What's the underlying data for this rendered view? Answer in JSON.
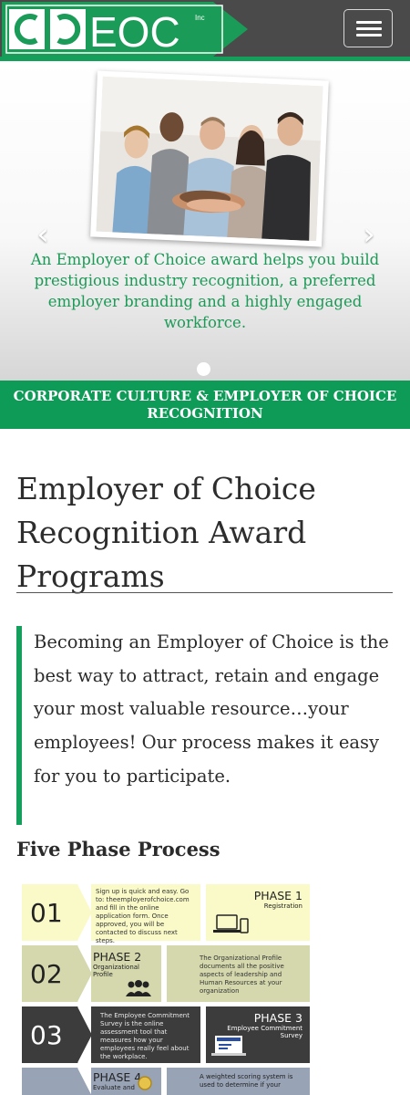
{
  "header": {
    "logo_text": "CCEOC",
    "logo_inc": "Inc",
    "menu_label": "Toggle navigation",
    "colors": {
      "bar": "#4a4a4a",
      "accent": "#149f5a",
      "logo_bg": "#1a9b57"
    }
  },
  "carousel": {
    "caption": "An Employer of Choice award helps you build prestigious industry recognition, a preferred employer branding and a highly engaged workforce.",
    "prev_icon": "chevron-left-icon",
    "next_icon": "chevron-right-icon",
    "active_slide": 1,
    "slide_count": 1
  },
  "banner": {
    "text": "CORPORATE CULTURE & EMPLOYER OF CHOICE RECOGNITION"
  },
  "main": {
    "title": "Employer of Choice Recognition Award Programs",
    "quote": "Becoming an Employer of Choice is the best way to attract, retain and engage your most valuable resource…your employees! Our process makes it easy for you to participate.",
    "subheading": "Five Phase Process"
  },
  "process": {
    "phases": [
      {
        "number": "01",
        "label": "PHASE 1",
        "sub": "Registration",
        "desc": "Sign up is quick and easy. Go to: theemployerofchoice.com and fill in the online application form. Once approved, you will be contacted to discuss next steps.",
        "icon": "devices-icon"
      },
      {
        "number": "02",
        "label": "PHASE 2",
        "sub": "Organizational Profile",
        "desc": "The Organizational Profile documents all the positive aspects of leadership and Human Resources at your organization",
        "icon": "people-icon"
      },
      {
        "number": "03",
        "label": "PHASE 3",
        "sub": "Employee Commitment Survey",
        "desc": "The Employee Commitment Survey is the online assessment tool that measures how your employees really feel about the workplace.",
        "icon": "laptop-survey-icon"
      },
      {
        "number": "04",
        "label": "PHASE 4",
        "sub": "Evaluate and",
        "desc": "A weighted scoring system is used to determine if your",
        "icon": "award-icon"
      }
    ]
  }
}
